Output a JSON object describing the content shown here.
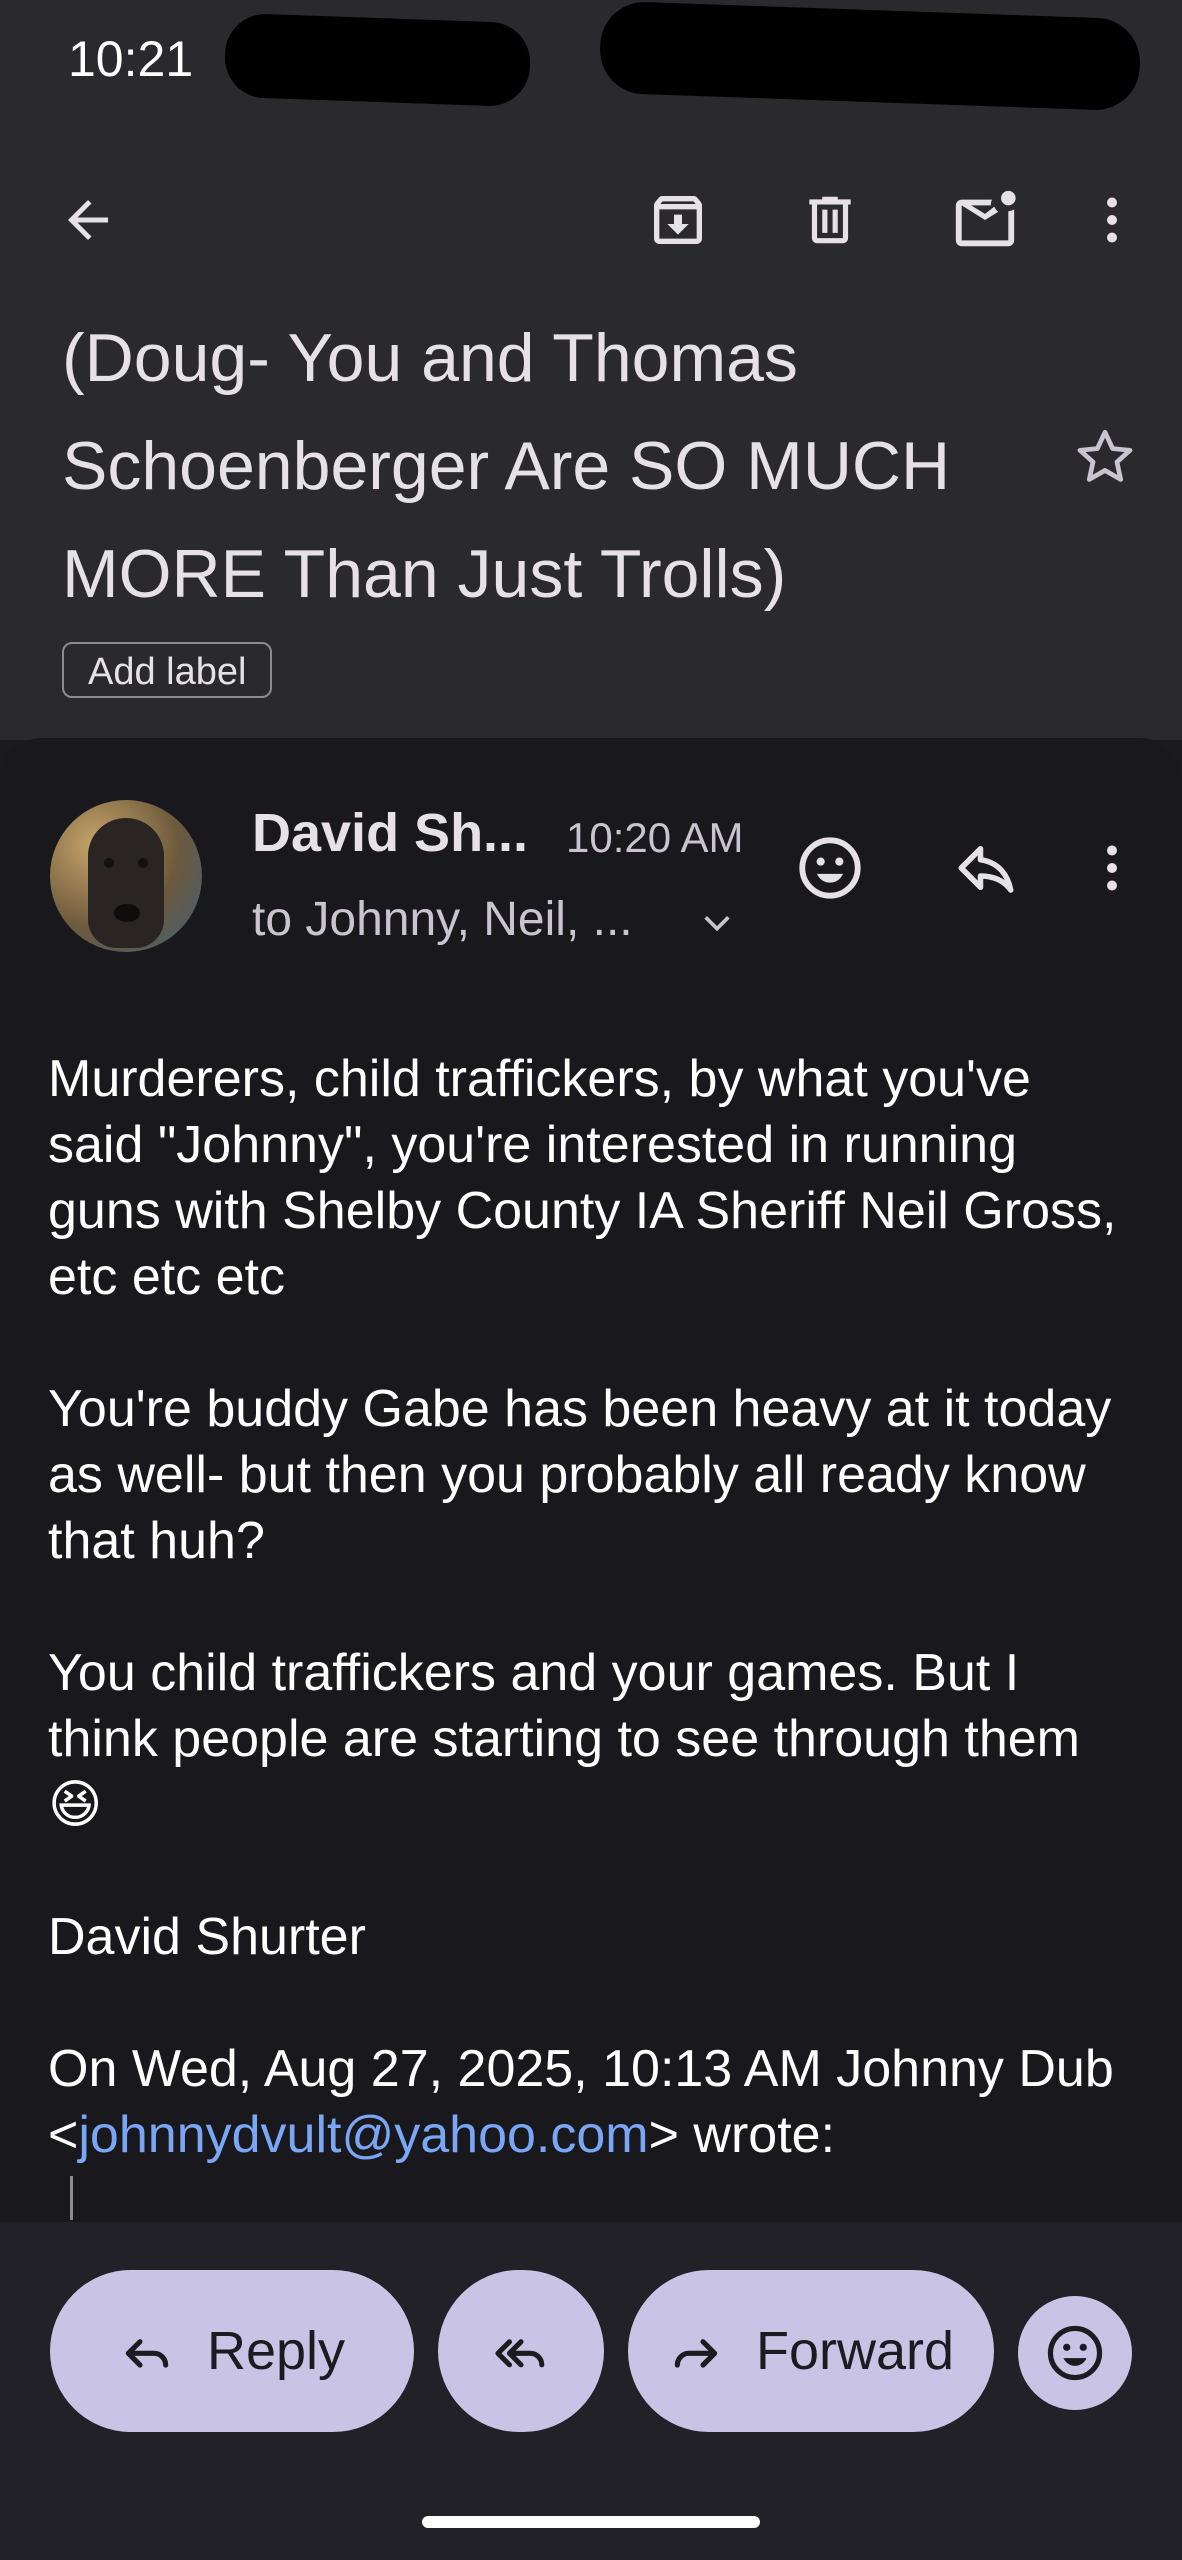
{
  "status_bar": {
    "time": "10:21"
  },
  "toolbar": {
    "back_icon": "arrow-back-icon",
    "archive_icon": "archive-icon",
    "delete_icon": "trash-icon",
    "mark_unread_icon": "mark-unread-icon",
    "more_icon": "more-vert-icon"
  },
  "email": {
    "subject": "(Doug- You and Thomas Schoenberger Are SO MUCH MORE Than Just Trolls)",
    "add_label": "Add label",
    "sender_name": "David Sh...",
    "time": "10:20 AM",
    "recipients": "to Johnny, Neil, ...",
    "body": {
      "p1": "Murderers, child traffickers, by what you've said \"Johnny\", you're interested in running guns with Shelby County IA Sheriff Neil Gross, etc etc etc",
      "p2": "You're buddy Gabe has been heavy at it today as well- but then you probably all ready know that huh?",
      "p3": "You child traffickers and your games. But I think people are starting to see through them 😆",
      "p4": "David Shurter",
      "quote_prefix": "On Wed, Aug 27, 2025, 10:13 AM Johnny Dub <",
      "quote_email": "johnnydvult@yahoo.com",
      "quote_suffix": "> wrote:"
    }
  },
  "actions": {
    "reply": "Reply",
    "forward": "Forward"
  },
  "colors": {
    "accent_pill": "#c9c3e6",
    "link": "#7aa7f5",
    "background": "#1b1b1f"
  }
}
